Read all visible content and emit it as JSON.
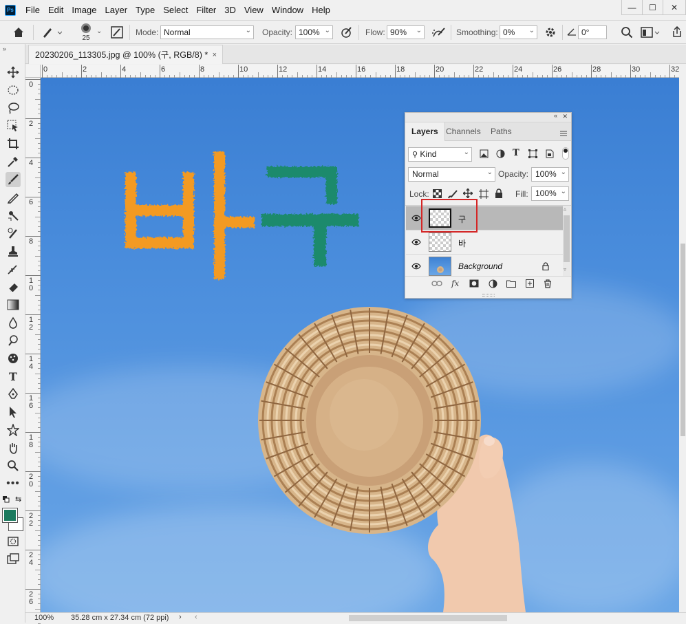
{
  "app": {
    "logo": "Ps"
  },
  "menu": [
    "File",
    "Edit",
    "Image",
    "Layer",
    "Type",
    "Select",
    "Filter",
    "3D",
    "View",
    "Window",
    "Help"
  ],
  "window_controls": {
    "minimize": "—",
    "maximize": "☐",
    "close": "✕"
  },
  "options": {
    "brush_size": "25",
    "mode_label": "Mode:",
    "mode_value": "Normal",
    "opacity_label": "Opacity:",
    "opacity_value": "100%",
    "flow_label": "Flow:",
    "flow_value": "90%",
    "smoothing_label": "Smoothing:",
    "smoothing_value": "0%",
    "angle_value": "0°"
  },
  "document_tab": {
    "title": "20230206_113305.jpg @ 100% (구, RGB/8) *",
    "close": "×"
  },
  "ruler_h": [
    "0",
    "2",
    "4",
    "6",
    "8",
    "10",
    "12",
    "14",
    "16",
    "18",
    "20",
    "22",
    "24",
    "26",
    "28",
    "30",
    "32"
  ],
  "ruler_v": [
    "0",
    "2",
    "4",
    "6",
    "8",
    "1\n0",
    "1\n2",
    "1\n4",
    "1\n6",
    "1\n8",
    "2\n0",
    "2\n2",
    "2\n4",
    "2\n6"
  ],
  "canvas_text": {
    "char1": "바",
    "char2": "구"
  },
  "colors": {
    "foreground": "#1a7a5e",
    "background": "#ffffff",
    "orange_text": "#f39a23",
    "green_text": "#1e8a6c",
    "highlight": "#d42626"
  },
  "layers_panel": {
    "tabs": [
      "Layers",
      "Channels",
      "Paths"
    ],
    "active_tab": "Layers",
    "filter_kind": "Kind",
    "blend_mode": "Normal",
    "opacity_label": "Opacity:",
    "opacity_value": "100%",
    "lock_label": "Lock:",
    "fill_label": "Fill:",
    "fill_value": "100%",
    "layers": [
      {
        "name": "구",
        "selected": true,
        "thumb": "transparent"
      },
      {
        "name": "바",
        "selected": false,
        "thumb": "transparent"
      },
      {
        "name": "Background",
        "selected": false,
        "thumb": "photo",
        "locked": true
      }
    ],
    "footer_fx": "fx"
  },
  "status": {
    "zoom": "100%",
    "doc_size": "35.28 cm x 27.34 cm (72 ppi)",
    "arrow": "›"
  }
}
